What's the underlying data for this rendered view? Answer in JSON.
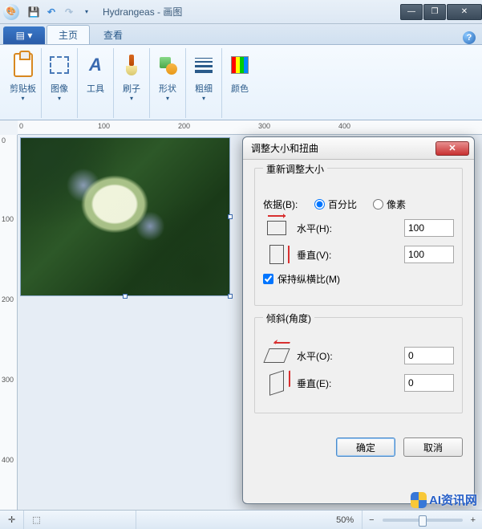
{
  "titlebar": {
    "doc_name": "Hydrangeas",
    "app_name": "画图"
  },
  "win_buttons": {
    "min": "—",
    "max": "❐",
    "close": "✕"
  },
  "ribbon": {
    "file_label": "▤ ▾",
    "tabs": {
      "home": "主页",
      "view": "查看"
    },
    "groups": {
      "clipboard": "剪贴板",
      "image": "图像",
      "tools": "工具",
      "brushes": "刷子",
      "shapes": "形状",
      "stroke": "粗细",
      "colors": "颜色"
    }
  },
  "ruler": {
    "h": {
      "t0": "0",
      "t100": "100",
      "t200": "200",
      "t300": "300",
      "t400": "400"
    },
    "v": {
      "t0": "0",
      "t100": "100",
      "t200": "200",
      "t300": "300",
      "t400": "400"
    }
  },
  "dialog": {
    "title": "调整大小和扭曲",
    "resize_legend": "重新调整大小",
    "by_label": "依据(B):",
    "percent": "百分比",
    "pixels": "像素",
    "horiz_label": "水平(H):",
    "vert_label": "垂直(V):",
    "horiz_value": "100",
    "vert_value": "100",
    "keep_ratio": "保持纵横比(M)",
    "skew_legend": "倾斜(角度)",
    "skew_h_label": "水平(O):",
    "skew_v_label": "垂直(E):",
    "skew_h_value": "0",
    "skew_v_value": "0",
    "ok": "确定",
    "cancel": "取消"
  },
  "statusbar": {
    "zoom": "50%",
    "minus": "−",
    "plus": "+"
  },
  "watermark": "AI资讯网"
}
